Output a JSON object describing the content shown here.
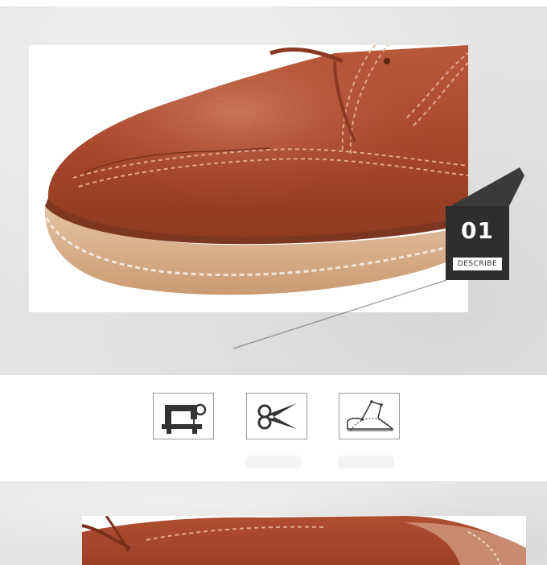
{
  "detail_section": {
    "badge": {
      "number": "01",
      "label": "DESCRIBE"
    }
  },
  "icons": [
    "sewing-machine-icon",
    "scissors-icon",
    "pattern-drafting-icon"
  ],
  "colors": {
    "background": "#e4e4e2",
    "leather": "#a9452a",
    "sole": "#d4a47c",
    "badge": "#2e2e2e"
  }
}
